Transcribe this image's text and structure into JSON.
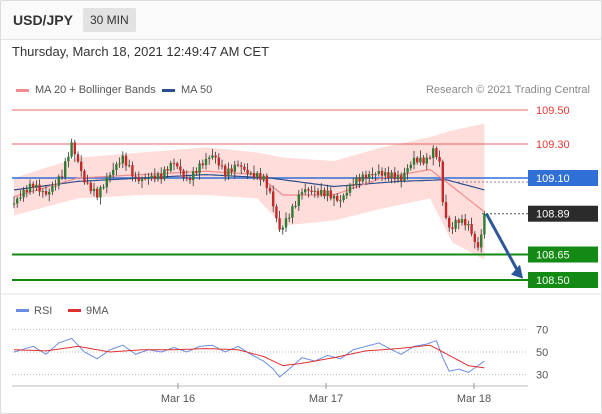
{
  "header": {
    "symbol": "USD/JPY",
    "timeframe": "30 MIN"
  },
  "datetime": "Thursday, March 18, 2021 12:49:47 AM CET",
  "credit": "Research © 2021 Trading Central",
  "legend": [
    {
      "label": "MA 20 + Bollinger Bands",
      "color": "#f28b8b"
    },
    {
      "label": "MA 50",
      "color": "#2c4f8e"
    }
  ],
  "rsi_legend": [
    {
      "label": "RSI",
      "color": "#6b8de3"
    },
    {
      "label": "9MA",
      "color": "#e03030"
    }
  ],
  "colors": {
    "up": "#2e7d32",
    "down": "#c62828",
    "resistance": "#e53935",
    "support": "#138a13",
    "pivot": "#2f6fd6",
    "last": "#2b2b2b",
    "band": "#ffd5d2",
    "arrow": "#2c579a"
  },
  "chart_data": [
    {
      "type": "candlestick",
      "title": "USD/JPY",
      "xlabel": "",
      "ylabel": "",
      "ylim": [
        108.4,
        109.6
      ],
      "x_ticks": [
        "Mar 16",
        "Mar 17",
        "Mar 18"
      ],
      "levels": [
        {
          "label": "109.50",
          "value": 109.5,
          "kind": "resistance"
        },
        {
          "label": "109.30",
          "value": 109.3,
          "kind": "resistance"
        },
        {
          "label": "109.10",
          "value": 109.1,
          "kind": "pivot"
        },
        {
          "label": "108.89",
          "value": 108.89,
          "kind": "last"
        },
        {
          "label": "108.65",
          "value": 108.65,
          "kind": "support"
        },
        {
          "label": "108.50",
          "value": 108.5,
          "kind": "support"
        }
      ],
      "anchors": [
        [
          0,
          108.95
        ],
        [
          6,
          109.05
        ],
        [
          10,
          109.02
        ],
        [
          15,
          109.12
        ],
        [
          18,
          109.28
        ],
        [
          22,
          109.08
        ],
        [
          26,
          109.02
        ],
        [
          30,
          109.12
        ],
        [
          34,
          109.2
        ],
        [
          38,
          109.1
        ],
        [
          42,
          109.12
        ],
        [
          46,
          109.1
        ],
        [
          50,
          109.18
        ],
        [
          54,
          109.1
        ],
        [
          58,
          109.18
        ],
        [
          62,
          109.22
        ],
        [
          66,
          109.12
        ],
        [
          70,
          109.2
        ],
        [
          74,
          109.12
        ],
        [
          78,
          109.08
        ],
        [
          80,
          109.0
        ],
        [
          83,
          108.8
        ],
        [
          86,
          108.9
        ],
        [
          90,
          109.02
        ],
        [
          94,
          109.0
        ],
        [
          98,
          109.02
        ],
        [
          102,
          108.98
        ],
        [
          106,
          109.06
        ],
        [
          110,
          109.1
        ],
        [
          114,
          109.15
        ],
        [
          118,
          109.12
        ],
        [
          121,
          109.08
        ],
        [
          125,
          109.2
        ],
        [
          129,
          109.22
        ],
        [
          131,
          109.28
        ],
        [
          133,
          109.2
        ],
        [
          134,
          108.95
        ],
        [
          136,
          108.78
        ],
        [
          139,
          108.84
        ],
        [
          142,
          108.83
        ],
        [
          145,
          108.7
        ],
        [
          147,
          108.89
        ]
      ],
      "ma20_anchors": [
        [
          0,
          108.99
        ],
        [
          20,
          109.1
        ],
        [
          40,
          109.12
        ],
        [
          60,
          109.14
        ],
        [
          76,
          109.12
        ],
        [
          84,
          109.0
        ],
        [
          100,
          109.0
        ],
        [
          115,
          109.1
        ],
        [
          130,
          109.15
        ],
        [
          137,
          109.05
        ],
        [
          147,
          108.9
        ]
      ],
      "bb_upper_anchors": [
        [
          0,
          109.1
        ],
        [
          20,
          109.22
        ],
        [
          40,
          109.25
        ],
        [
          60,
          109.28
        ],
        [
          76,
          109.25
        ],
        [
          84,
          109.22
        ],
        [
          100,
          109.2
        ],
        [
          115,
          109.28
        ],
        [
          130,
          109.34
        ],
        [
          137,
          109.38
        ],
        [
          147,
          109.42
        ]
      ],
      "bb_lower_anchors": [
        [
          0,
          108.88
        ],
        [
          20,
          108.98
        ],
        [
          40,
          109.0
        ],
        [
          60,
          109.0
        ],
        [
          76,
          108.98
        ],
        [
          84,
          108.82
        ],
        [
          100,
          108.85
        ],
        [
          115,
          108.92
        ],
        [
          130,
          108.98
        ],
        [
          137,
          108.72
        ],
        [
          147,
          108.62
        ]
      ],
      "ma50_anchors": [
        [
          0,
          109.03
        ],
        [
          20,
          109.08
        ],
        [
          40,
          109.1
        ],
        [
          60,
          109.12
        ],
        [
          80,
          109.1
        ],
        [
          100,
          109.05
        ],
        [
          120,
          109.08
        ],
        [
          135,
          109.09
        ],
        [
          147,
          109.03
        ]
      ]
    },
    {
      "type": "line",
      "title": "RSI",
      "ylim": [
        20,
        80
      ],
      "y_ticks": [
        70,
        50,
        30
      ],
      "rsi_anchors": [
        [
          0,
          50
        ],
        [
          6,
          55
        ],
        [
          10,
          48
        ],
        [
          14,
          58
        ],
        [
          18,
          62
        ],
        [
          22,
          50
        ],
        [
          26,
          44
        ],
        [
          30,
          52
        ],
        [
          34,
          56
        ],
        [
          38,
          48
        ],
        [
          42,
          52
        ],
        [
          46,
          50
        ],
        [
          50,
          54
        ],
        [
          54,
          50
        ],
        [
          58,
          55
        ],
        [
          62,
          56
        ],
        [
          66,
          50
        ],
        [
          70,
          55
        ],
        [
          74,
          48
        ],
        [
          78,
          42
        ],
        [
          81,
          35
        ],
        [
          83,
          28
        ],
        [
          86,
          35
        ],
        [
          90,
          45
        ],
        [
          94,
          42
        ],
        [
          98,
          47
        ],
        [
          102,
          44
        ],
        [
          106,
          52
        ],
        [
          110,
          55
        ],
        [
          114,
          58
        ],
        [
          118,
          52
        ],
        [
          121,
          48
        ],
        [
          125,
          55
        ],
        [
          129,
          57
        ],
        [
          132,
          60
        ],
        [
          134,
          45
        ],
        [
          136,
          33
        ],
        [
          139,
          35
        ],
        [
          142,
          32
        ],
        [
          145,
          38
        ],
        [
          147,
          42
        ]
      ],
      "ma9_anchors": [
        [
          0,
          52
        ],
        [
          10,
          51
        ],
        [
          20,
          55
        ],
        [
          30,
          50
        ],
        [
          40,
          52
        ],
        [
          50,
          52
        ],
        [
          60,
          53
        ],
        [
          70,
          52
        ],
        [
          78,
          46
        ],
        [
          84,
          38
        ],
        [
          90,
          40
        ],
        [
          100,
          45
        ],
        [
          110,
          51
        ],
        [
          120,
          53
        ],
        [
          130,
          56
        ],
        [
          136,
          47
        ],
        [
          142,
          38
        ],
        [
          147,
          36
        ]
      ]
    }
  ]
}
